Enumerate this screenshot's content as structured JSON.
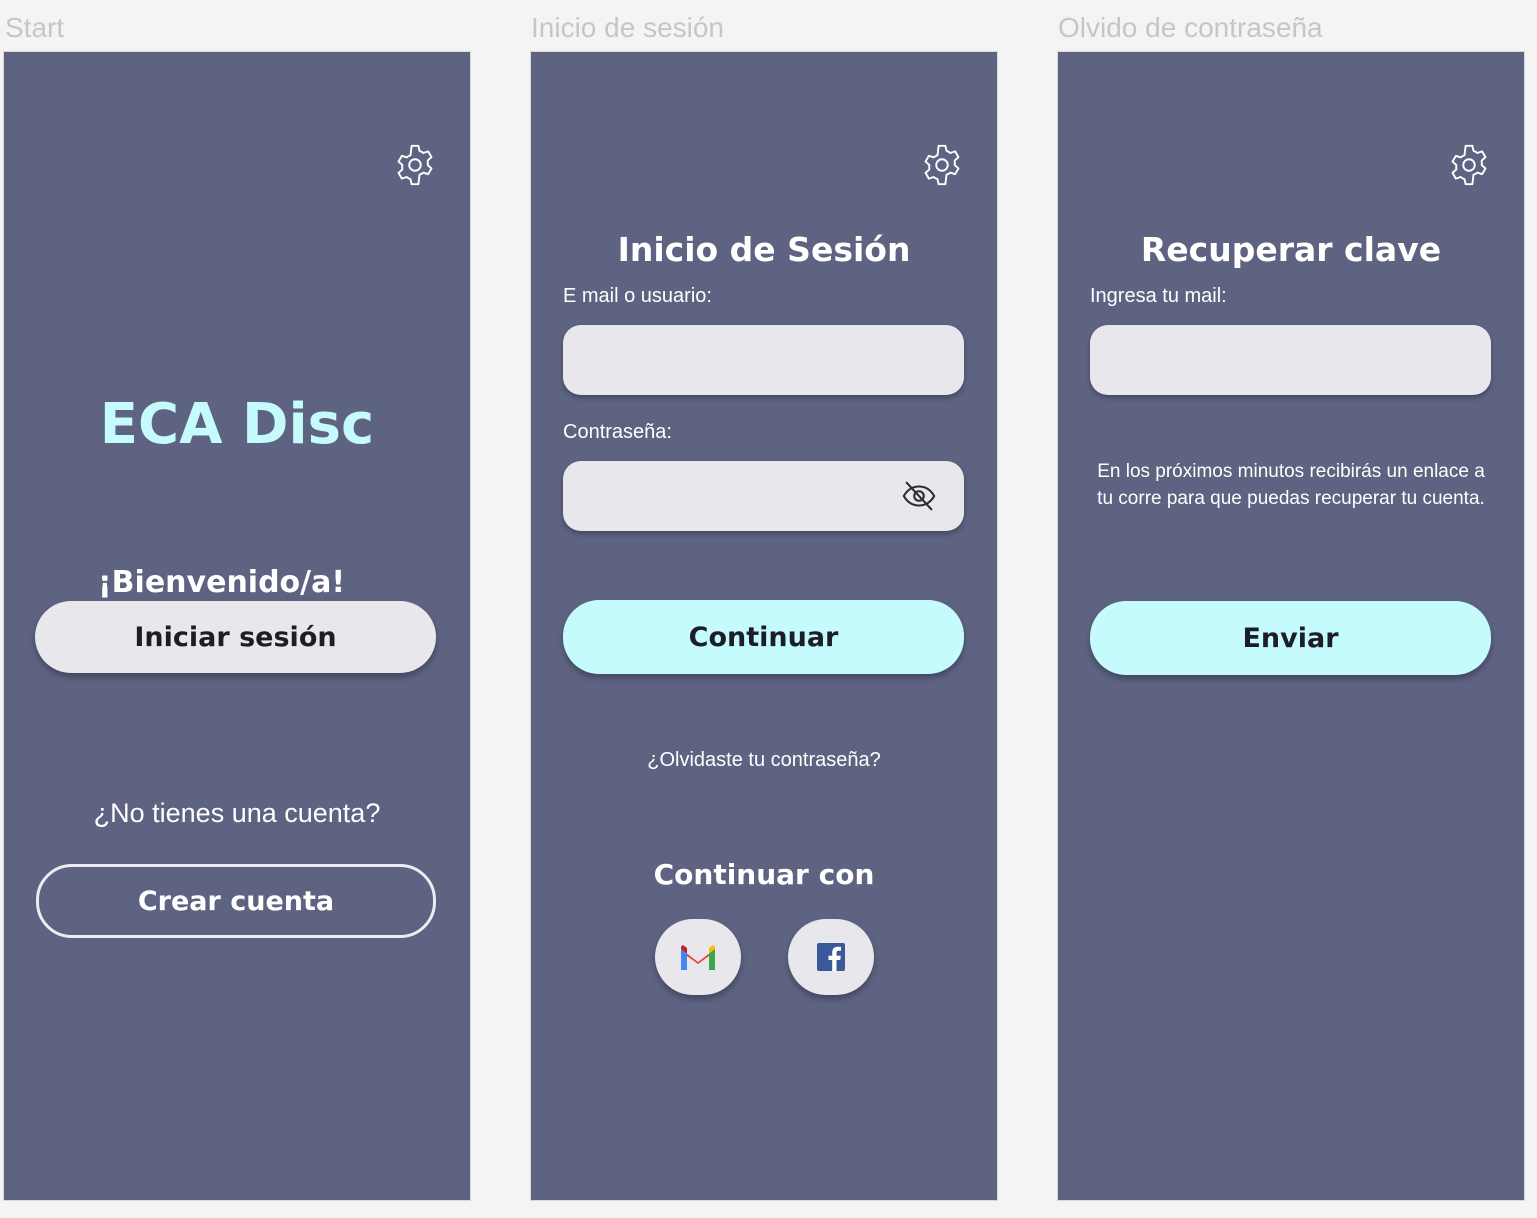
{
  "colors": {
    "canvas": "#f4f4f4",
    "screen_bg": "#5d6380",
    "accent_cyan": "#c5fbfc",
    "light_pill": "#e8e7ec",
    "frame_label": "#c6c6c6"
  },
  "frames": [
    {
      "label": "Start"
    },
    {
      "label": "Inicio de sesión"
    },
    {
      "label": "Olvido de contraseña"
    }
  ],
  "start": {
    "gear_icon": "gear-icon",
    "app_title": "ECA Disc",
    "welcome": "¡Bienvenido/a!",
    "login_button": "Iniciar sesión",
    "no_account": "¿No tienes una cuenta?",
    "create_account_button": "Crear cuenta"
  },
  "login": {
    "gear_icon": "gear-icon",
    "title": "Inicio de Sesión",
    "email_label": "E mail o usuario:",
    "email_value": "",
    "password_label": "Contraseña:",
    "password_value": "",
    "eye_icon": "eye-off-icon",
    "continue_button": "Continuar",
    "forgot_link": "¿Olvidaste tu contraseña?",
    "continue_with": "Continuar con",
    "social": [
      {
        "icon": "gmail-icon"
      },
      {
        "icon": "facebook-icon"
      }
    ]
  },
  "recover": {
    "gear_icon": "gear-icon",
    "title": "Recuperar clave",
    "email_label": "Ingresa tu mail:",
    "email_value": "",
    "info_line1": "En los próximos minutos recibirás un enlace a",
    "info_line2": "tu corre para que puedas recuperar tu cuenta.",
    "send_button": "Enviar"
  }
}
